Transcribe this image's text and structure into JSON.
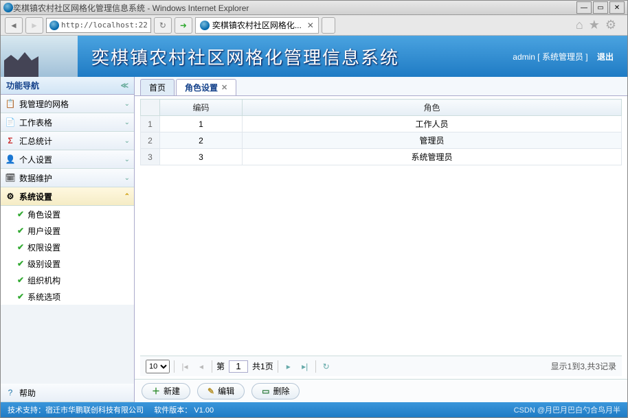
{
  "window": {
    "title": "奕棋镇农村社区网格化管理信息系统 - Windows Internet Explorer"
  },
  "address": {
    "url": "http://localhost:22",
    "tab_label": "奕棋镇农村社区网格化..."
  },
  "banner": {
    "title": "奕棋镇农村社区网格化管理信息系统",
    "user": "admin",
    "role_label": "[ 系统管理员 ]",
    "logout": "退出"
  },
  "sidebar": {
    "title": "功能导航",
    "items": [
      {
        "label": "我管理的网格",
        "icon": "📋"
      },
      {
        "label": "工作表格",
        "icon": "📄"
      },
      {
        "label": "汇总统计",
        "icon": "Σ"
      },
      {
        "label": "个人设置",
        "icon": "👤"
      },
      {
        "label": "数据维护",
        "icon": "🗓"
      },
      {
        "label": "系统设置",
        "icon": "⚙"
      }
    ],
    "submenu": [
      {
        "label": "角色设置"
      },
      {
        "label": "用户设置"
      },
      {
        "label": "权限设置"
      },
      {
        "label": "级别设置"
      },
      {
        "label": "组织机构"
      },
      {
        "label": "系统选项"
      }
    ],
    "help": "帮助"
  },
  "tabs": {
    "home": "首页",
    "current": "角色设置"
  },
  "grid": {
    "headers": {
      "code": "编码",
      "role": "角色"
    },
    "rows": [
      {
        "n": "1",
        "code": "1",
        "role": "工作人员"
      },
      {
        "n": "2",
        "code": "2",
        "role": "管理员"
      },
      {
        "n": "3",
        "code": "3",
        "role": "系统管理员"
      }
    ]
  },
  "pager": {
    "pagesize": "10",
    "page_label_pre": "第",
    "page": "1",
    "page_label_post": "共1页",
    "summary": "显示1到3,共3记录"
  },
  "toolbar": {
    "new": "新建",
    "edit": "编辑",
    "del": "删除"
  },
  "footer": {
    "support": "技术支持：宿迁市华鹏联创科技有限公司",
    "version_label": "软件版本：",
    "version": "V1.00",
    "watermark": "CSDN @月巴月巴白勺合鸟月半"
  }
}
